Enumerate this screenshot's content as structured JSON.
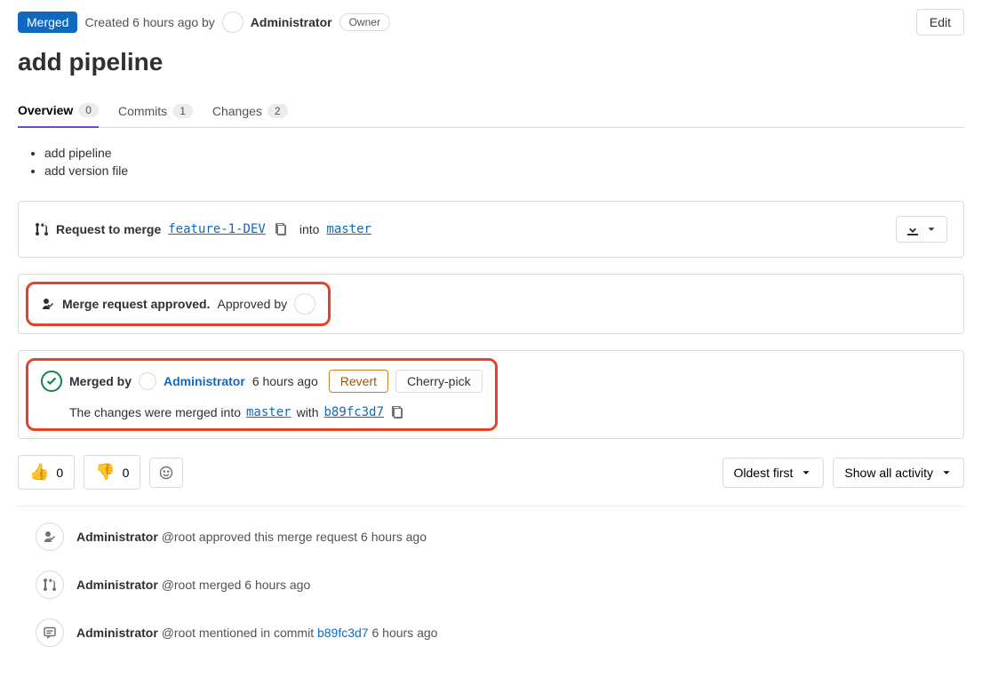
{
  "header": {
    "status_badge": "Merged",
    "created_text": "Created 6 hours ago by",
    "author": "Administrator",
    "role_badge": "Owner",
    "edit_label": "Edit"
  },
  "title": "add pipeline",
  "tabs": {
    "overview": {
      "label": "Overview",
      "count": "0"
    },
    "commits": {
      "label": "Commits",
      "count": "1"
    },
    "changes": {
      "label": "Changes",
      "count": "2"
    }
  },
  "description": {
    "items": [
      "add pipeline",
      "add version file"
    ]
  },
  "merge_request": {
    "request_text": "Request to merge",
    "source_branch": "feature-1-DEV",
    "into_text": "into",
    "target_branch": "master"
  },
  "approval": {
    "approved_text": "Merge request approved.",
    "approved_by_text": "Approved by"
  },
  "merged": {
    "merged_by_text": "Merged by",
    "author": "Administrator",
    "time": "6 hours ago",
    "revert_label": "Revert",
    "cherry_label": "Cherry-pick",
    "changes_text_1": "The changes were merged into",
    "target_branch": "master",
    "changes_text_2": "with",
    "commit_sha": "b89fc3d7"
  },
  "reactions": {
    "thumbs_up": "0",
    "thumbs_down": "0"
  },
  "sort": {
    "oldest_first": "Oldest first",
    "show_all": "Show all activity"
  },
  "activity": {
    "approved": {
      "author": "Administrator",
      "handle": "@root",
      "action": "approved this merge request",
      "time": "6 hours ago"
    },
    "merged": {
      "author": "Administrator",
      "handle": "@root",
      "action": "merged",
      "time": "6 hours ago"
    },
    "mentioned": {
      "author": "Administrator",
      "handle": "@root",
      "action": "mentioned in commit",
      "commit": "b89fc3d7",
      "time": "6 hours ago"
    }
  }
}
